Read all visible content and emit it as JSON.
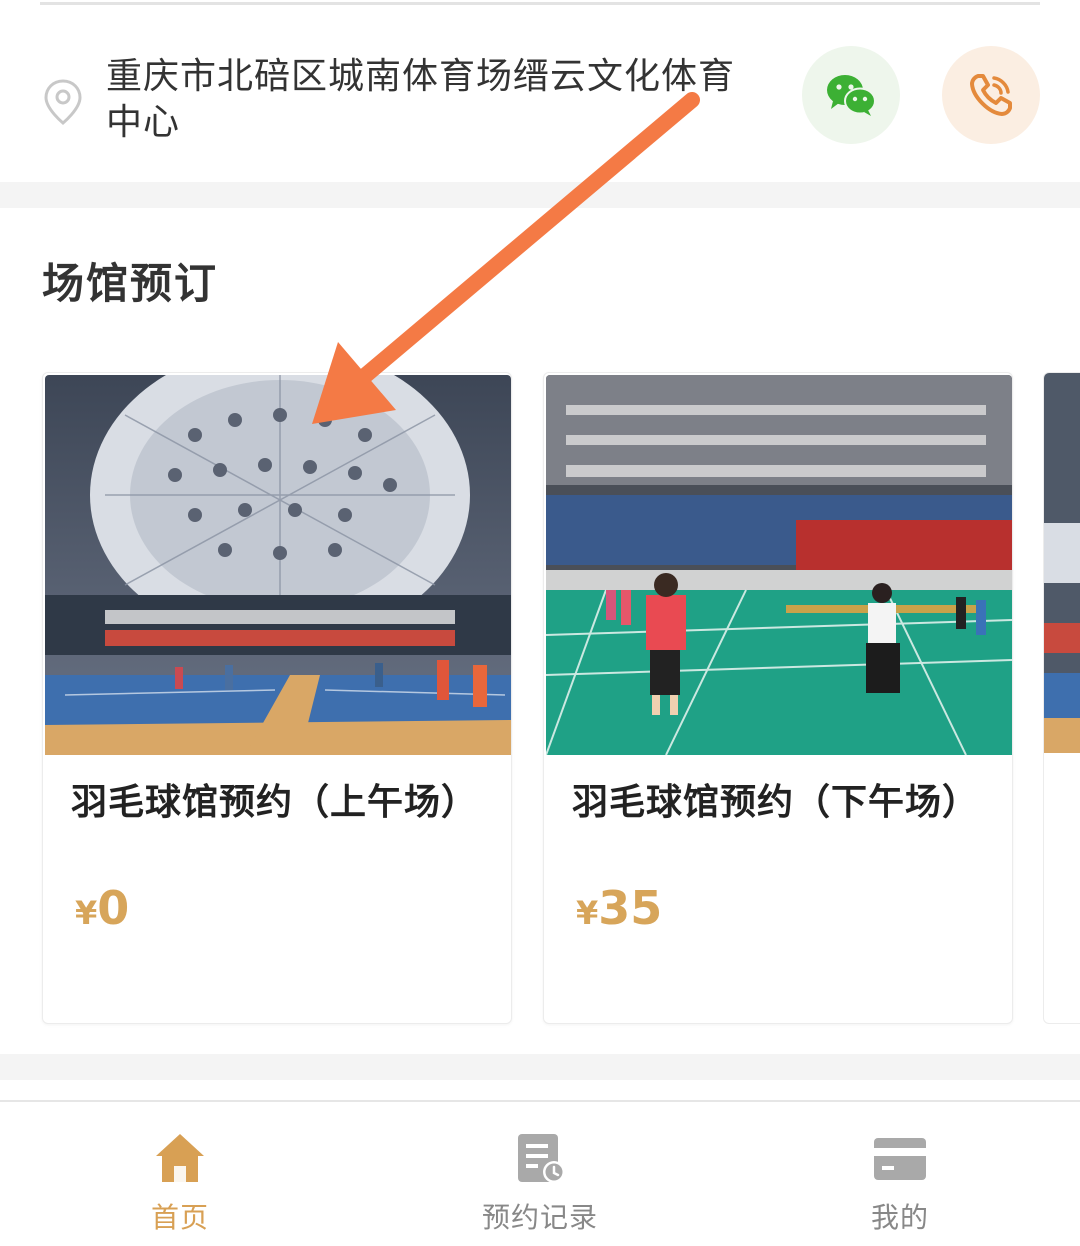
{
  "address": {
    "text": "重庆市北碚区城南体育场缙云文化体育中心",
    "line1": "重庆市北碚区城南体育场缙云文化体育",
    "line2": "中心"
  },
  "icons": {
    "location": "location-pin-icon",
    "wechat": "wechat-icon",
    "phone": "phone-icon"
  },
  "section": {
    "title": "场馆预订"
  },
  "cards": [
    {
      "title": "羽毛球馆预约（上午场）",
      "currency": "¥",
      "price": "0"
    },
    {
      "title": "羽毛球馆预约（下午场）",
      "currency": "¥",
      "price": "35"
    }
  ],
  "tabs": [
    {
      "label": "首页",
      "active": true
    },
    {
      "label": "预约记录",
      "active": false
    },
    {
      "label": "我的",
      "active": false
    }
  ],
  "colors": {
    "accent": "#d8a054",
    "price": "#d7a55a",
    "wechat_green": "#3cb034",
    "phone_orange": "#e48a3c",
    "annotation_arrow": "#f47a45"
  }
}
